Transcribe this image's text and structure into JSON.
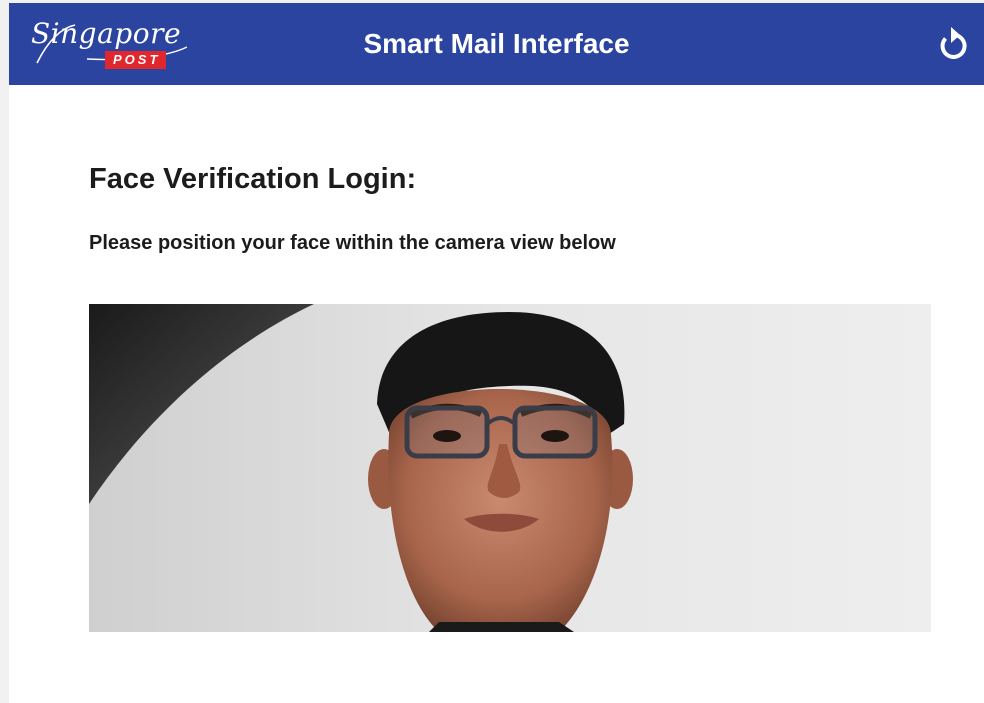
{
  "header": {
    "logo_script": "Singapore",
    "logo_badge": "POST",
    "title": "Smart Mail Interface",
    "refresh_icon": "refresh-icon"
  },
  "main": {
    "heading": "Face Verification Login:",
    "instruction": "Please position your face within the camera view below"
  },
  "colors": {
    "header_background": "#2a44a0",
    "logo_badge": "#e1272e",
    "page_background": "#ffffff",
    "text": "#1c1c1c"
  }
}
